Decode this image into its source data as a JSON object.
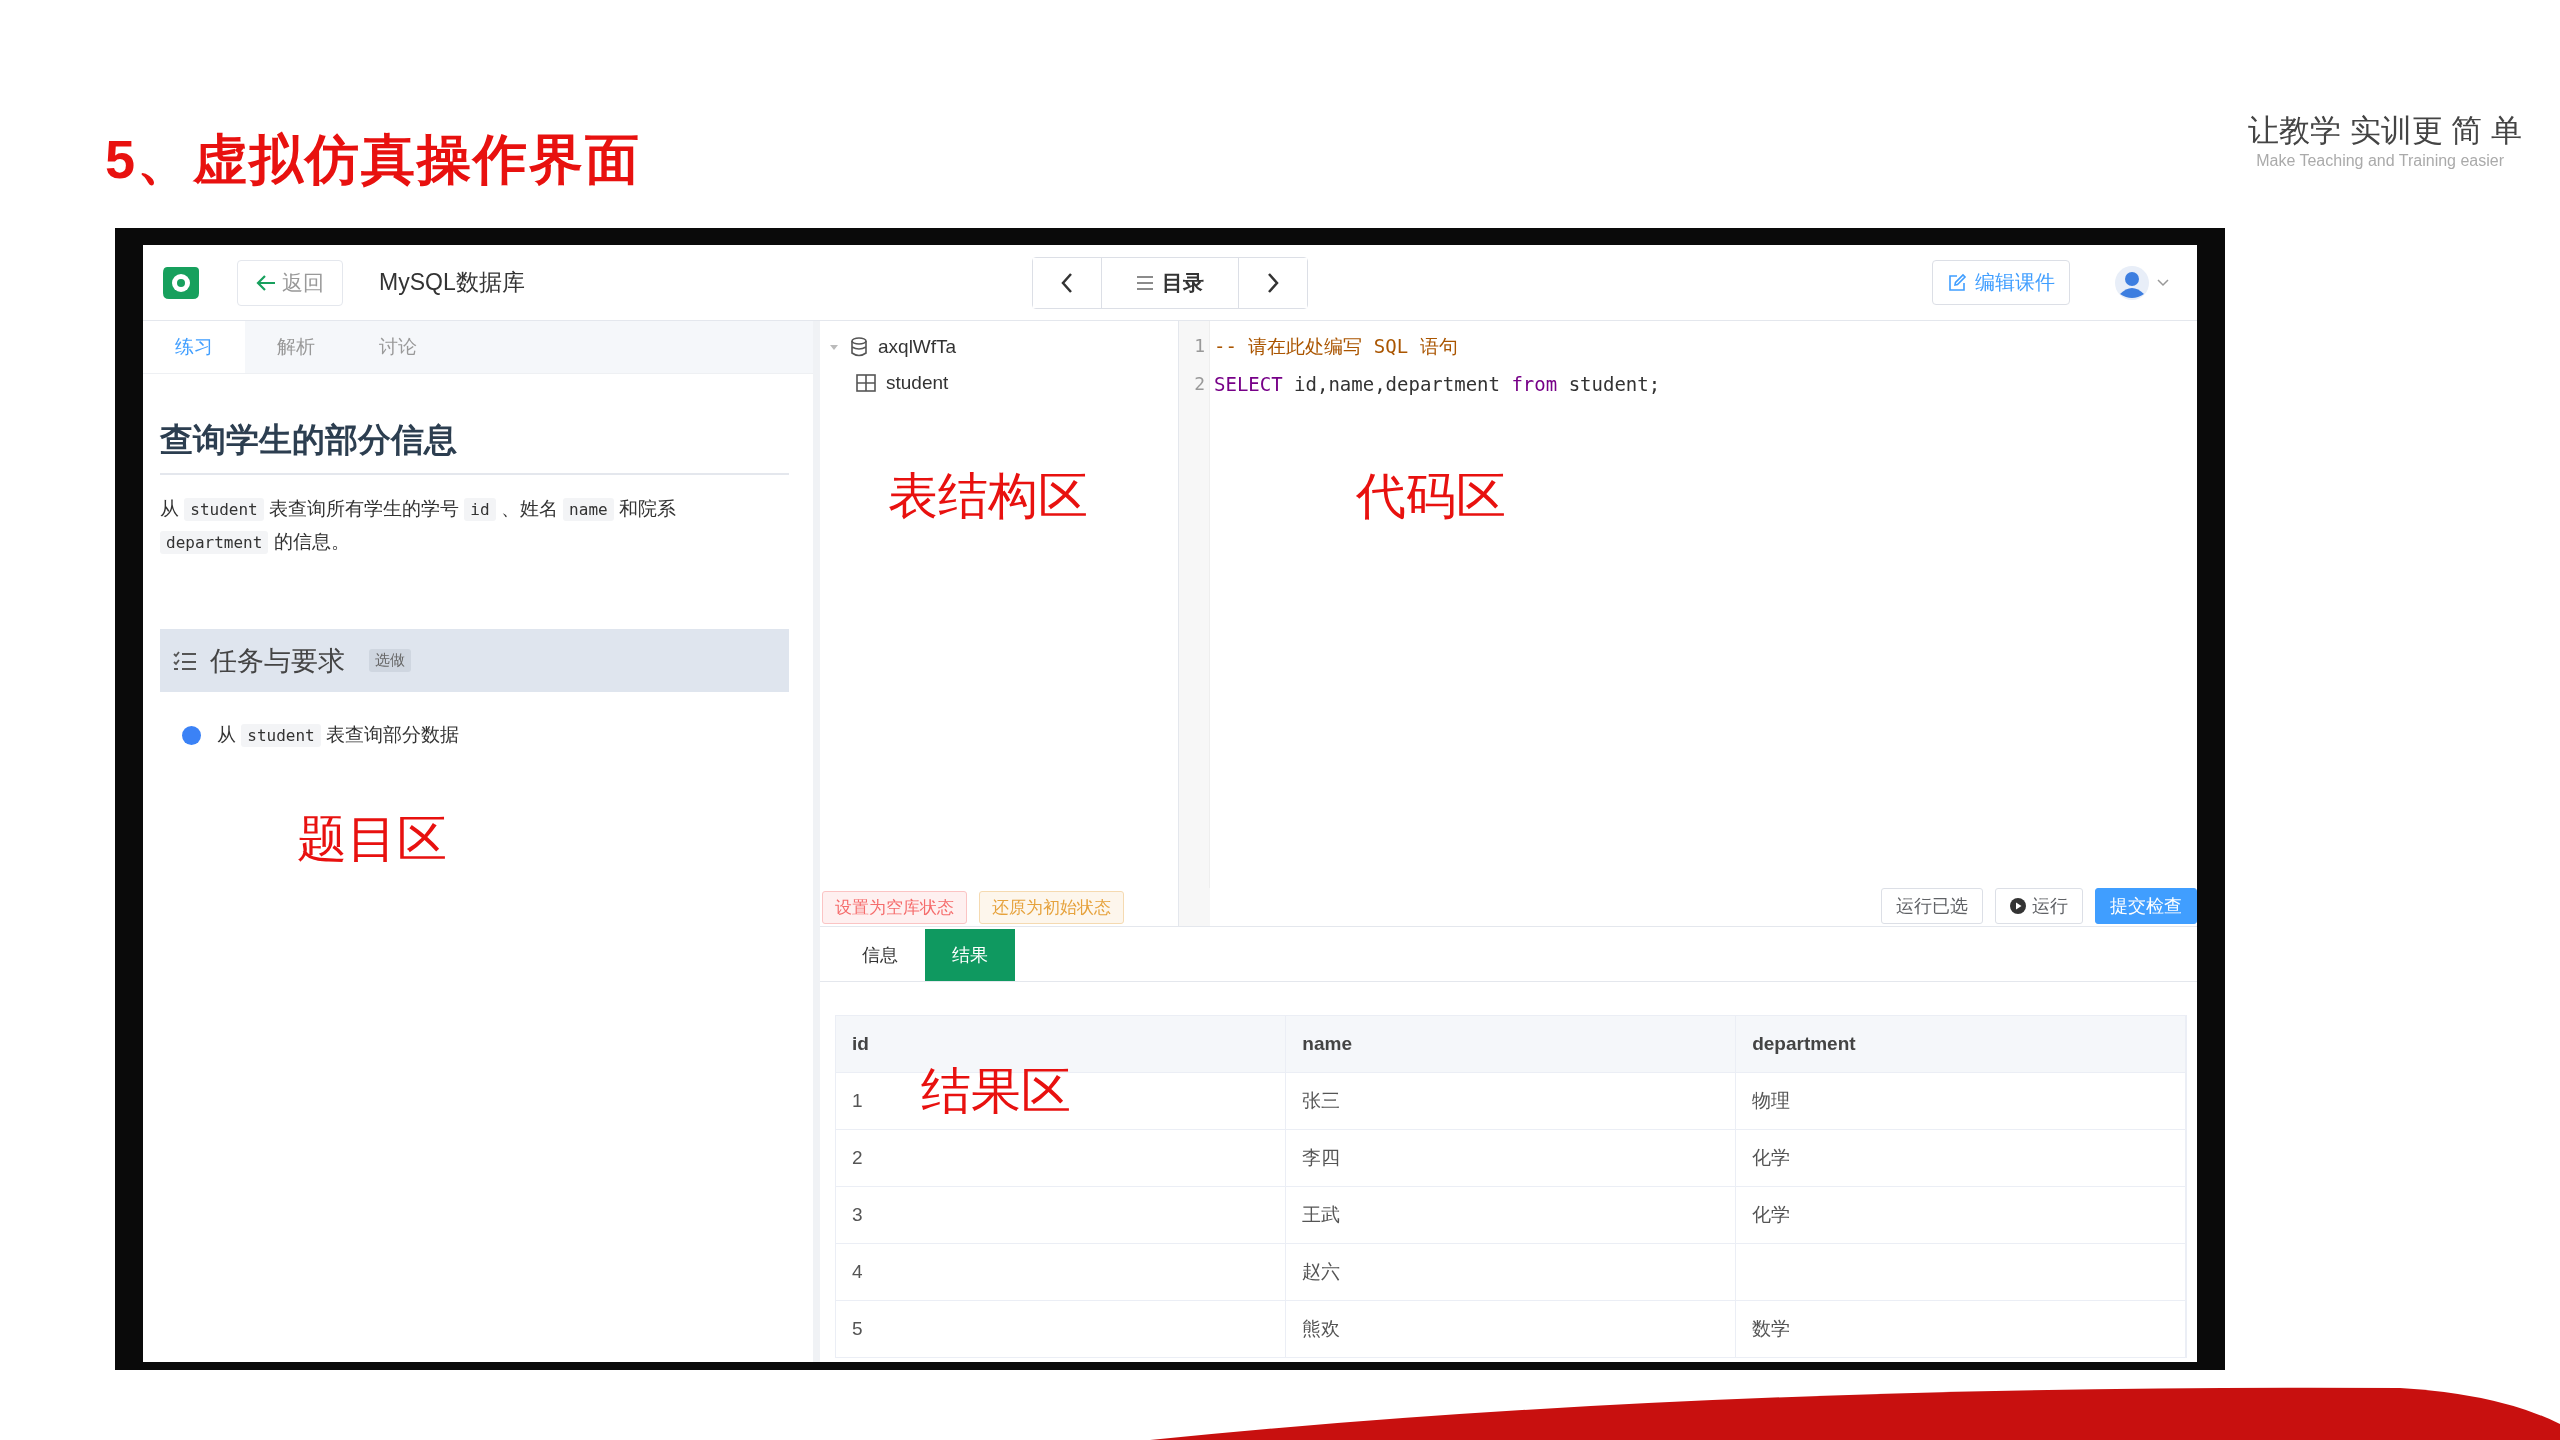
{
  "slide": {
    "title": "5、虚拟仿真操作界面",
    "tagline": "让教学 实训更 简 单",
    "tagline_en": "Make Teaching and Training easier"
  },
  "app": {
    "header": {
      "back": "返回",
      "title": "MySQL数据库",
      "menu": "目录",
      "edit": "编辑课件"
    },
    "left_tabs": [
      {
        "label": "练习",
        "selected": true
      },
      {
        "label": "解析",
        "selected": false
      },
      {
        "label": "讨论",
        "selected": false
      }
    ],
    "problem": {
      "title": "查询学生的部分信息",
      "description": [
        {
          "kind": "text",
          "text": "从 "
        },
        {
          "kind": "code",
          "text": "student"
        },
        {
          "kind": "text",
          "text": " 表查询所有学生的学号 "
        },
        {
          "kind": "code",
          "text": "id"
        },
        {
          "kind": "text",
          "text": " 、姓名 "
        },
        {
          "kind": "code",
          "text": "name"
        },
        {
          "kind": "text",
          "text": " 和院系 "
        },
        {
          "kind": "code",
          "text": "department"
        },
        {
          "kind": "text",
          "text": " 的信息。"
        }
      ],
      "task_header": {
        "title": "任务与要求",
        "badge": "选做"
      },
      "tasks": [
        {
          "segments": [
            {
              "kind": "text",
              "text": "从 "
            },
            {
              "kind": "code",
              "text": "student"
            },
            {
              "kind": "text",
              "text": " 表查询部分数据"
            }
          ]
        }
      ],
      "annotation": "题目区"
    },
    "tree": {
      "items": [
        {
          "label": "axqlWfTa",
          "expanded": true,
          "children": [
            {
              "label": "student"
            }
          ]
        }
      ],
      "annotation": "表结构区",
      "buttons": [
        {
          "label": "设置为空库状态",
          "kind": "danger"
        },
        {
          "label": "还原为初始状态",
          "kind": "warning"
        }
      ]
    },
    "editor": {
      "lines": [
        {
          "number": "1",
          "tokens": [
            {
              "kind": "comment",
              "text": "-- 请在此处编写 SQL 语句"
            }
          ]
        },
        {
          "number": "2",
          "tokens": [
            {
              "kind": "keyword",
              "text": "SELECT"
            },
            {
              "kind": "plain",
              "text": " id,name,department "
            },
            {
              "kind": "keyword",
              "text": "from"
            },
            {
              "kind": "plain",
              "text": " student;"
            }
          ]
        }
      ],
      "annotation": "代码区",
      "buttons": [
        {
          "label": "运行已选",
          "kind": "default"
        },
        {
          "label": "运行",
          "kind": "run"
        },
        {
          "label": "提交检查",
          "kind": "primary"
        }
      ]
    },
    "result_tabs": [
      {
        "label": "信息",
        "selected": false
      },
      {
        "label": "结果",
        "selected": true
      }
    ],
    "table": {
      "columns": [
        "id",
        "name",
        "department"
      ],
      "rows": [
        [
          "1",
          "张三",
          "物理"
        ],
        [
          "2",
          "李四",
          "化学"
        ],
        [
          "3",
          "王武",
          "化学"
        ],
        [
          "4",
          "赵六",
          null
        ],
        [
          "5",
          "熊欢",
          "数学"
        ]
      ],
      "annotation": "结果区"
    }
  }
}
